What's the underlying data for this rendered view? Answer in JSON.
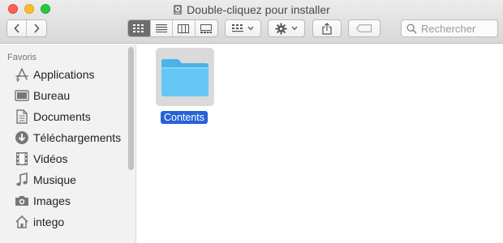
{
  "window": {
    "title": "Double-cliquez pour installer",
    "title_icon": "disk-image-icon"
  },
  "toolbar": {
    "back_icon": "chevron-left-icon",
    "forward_icon": "chevron-right-icon",
    "view_modes": [
      "icon-view",
      "list-view",
      "column-view",
      "gallery-view"
    ],
    "active_view": "icon-view",
    "group_icon": "group-by-icon",
    "action_icon": "gear-icon",
    "share_icon": "share-icon",
    "tag_icon": "tag-icon"
  },
  "search": {
    "placeholder": "Rechercher",
    "value": ""
  },
  "sidebar": {
    "heading": "Favoris",
    "items": [
      {
        "label": "Applications",
        "icon": "applications-icon"
      },
      {
        "label": "Bureau",
        "icon": "desktop-icon"
      },
      {
        "label": "Documents",
        "icon": "document-icon"
      },
      {
        "label": "Téléchargements",
        "icon": "download-icon"
      },
      {
        "label": "Vidéos",
        "icon": "film-icon"
      },
      {
        "label": "Musique",
        "icon": "music-note-icon"
      },
      {
        "label": "Images",
        "icon": "camera-icon"
      },
      {
        "label": "intego",
        "icon": "home-icon"
      }
    ]
  },
  "content": {
    "items": [
      {
        "name": "Contents",
        "kind": "folder",
        "selected": true
      }
    ]
  },
  "colors": {
    "selection": "#2762d9",
    "folder": "#5ec6f7",
    "close": "#fe5f57",
    "minimize": "#febc2e",
    "zoom": "#28c840"
  }
}
